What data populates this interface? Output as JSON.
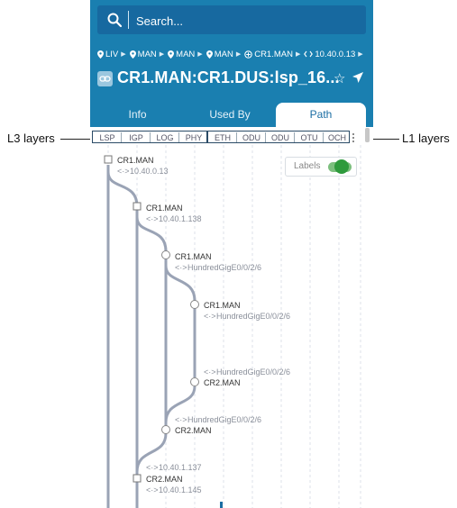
{
  "annotations": {
    "left": "L3 layers",
    "right": "L1 layers"
  },
  "search": {
    "placeholder": "Search..."
  },
  "breadcrumb": [
    {
      "icon": "location-pin-icon",
      "label": "LIV"
    },
    {
      "icon": "location-pin-icon",
      "label": "MAN"
    },
    {
      "icon": "location-pin-icon",
      "label": "MAN"
    },
    {
      "icon": "location-pin-icon",
      "label": "MAN"
    },
    {
      "icon": "router-icon",
      "label": "CR1.MAN"
    },
    {
      "icon": "link-icon",
      "label": "10.40.0.13"
    }
  ],
  "title": "CR1.MAN:CR1.DUS:lsp_16...",
  "tabs": [
    {
      "label": "Info",
      "active": false
    },
    {
      "label": "Used By",
      "active": false
    },
    {
      "label": "Path",
      "active": true
    }
  ],
  "layers": {
    "l3": [
      "LSP",
      "IGP",
      "LOG",
      "PHY"
    ],
    "l1": [
      "ETH",
      "ODU",
      "ODU",
      "OTU",
      "OCH"
    ]
  },
  "labels_toggle": {
    "label": "Labels",
    "on": true
  },
  "nodes": [
    {
      "name": "CR1.MAN",
      "detail": "10.40.0.13"
    },
    {
      "name": "CR1.MAN",
      "detail": "10.40.1.138"
    },
    {
      "name": "CR1.MAN",
      "detail": "HundredGigE0/0/2/6"
    },
    {
      "name": "CR1.MAN",
      "detail": "HundredGigE0/0/2/6"
    },
    {
      "name": "CR2.MAN",
      "detail": "HundredGigE0/0/2/6"
    },
    {
      "name": "CR2.MAN",
      "detail": "HundredGigE0/0/2/6"
    },
    {
      "name": "CR2.MAN",
      "detail": "10.40.1.137"
    },
    {
      "name": "",
      "detail": "10.40.1.145"
    }
  ],
  "colors": {
    "header": "#1a7fb0",
    "accent": "#1a6da3",
    "toggle_on": "#2e9a3c",
    "path_line": "#9aa3b5"
  }
}
